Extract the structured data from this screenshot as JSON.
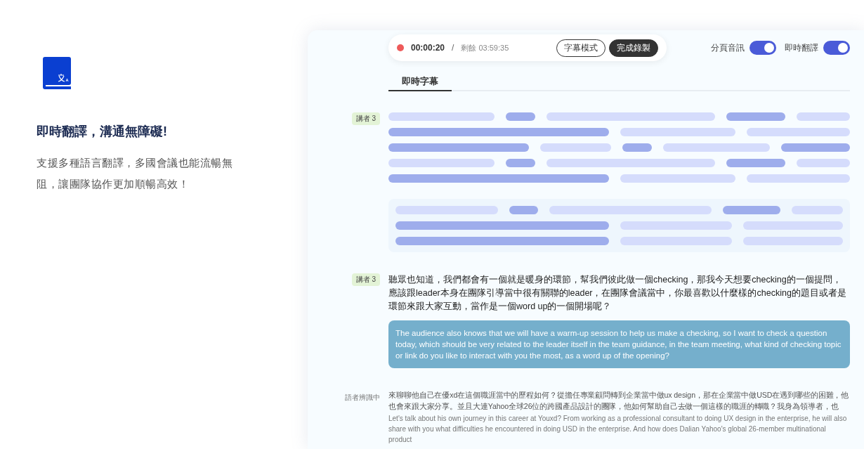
{
  "feature": {
    "title": "即時翻譯，溝通無障礙!",
    "description": "支援多種語言翻譯，多國會議也能流暢無阻，讓團隊協作更加順暢高效！"
  },
  "recorder": {
    "recording": true,
    "elapsed": "00:00:20",
    "separator": "/",
    "remaining": "剩餘 03:59:35",
    "buttons": [
      {
        "label": "字幕模式",
        "kind": "outline"
      },
      {
        "label": "完成錄製",
        "kind": "filled"
      }
    ]
  },
  "toggles": [
    {
      "label": "分頁音訊",
      "on": true
    },
    {
      "label": "即時翻譯",
      "on": true
    }
  ],
  "tabs": [
    {
      "label": "即時字幕",
      "selected": true
    }
  ],
  "transcript": [
    {
      "kind": "skeleton",
      "speaker": "講者 3"
    },
    {
      "kind": "translated",
      "speaker": "講者 3",
      "text": "聽眾也知道，我們都會有一個就是暖身的環節，幫我們彼此做一個checking，那我今天想要checking的一個提問，應該跟leader本身在團隊引導當中很有關聯的leader，在團隊會議當中，你最喜歡以什麼樣的checking的題目或者是環節來跟大家互動，當作是一個word up的一個開場呢？",
      "translation": "The audience also knows that we will have a warm-up session to help us make a checking, so I want to check a question today, which should be very related to the leader itself in the team guidance, in the team meeting, what kind of checking topic or link do you like to interact with you the most, as a word up of the opening?"
    },
    {
      "kind": "recognizing",
      "speaker": "語者辨識中",
      "text": "來聊聊他自己在優xd在這個職涯當中的歷程如何？從擔任專業顧問轉到企業當中做ux design，那在企業當中做USD在遇到哪些的困難，他也會來跟大家分享。並且大連Yahoo全球26位的跨國產品設計的團隊，他如何幫助自己去做一個這樣的職涯的轉職？我身為領導者，也",
      "translation": "Let's talk about his own journey in this career at Youxd? From working as a professional consultant to doing UX design in the enterprise, he will also share with you what difficulties he encountered in doing USD in the enterprise. And how does Dalian Yahoo's global 26-member multinational product"
    }
  ]
}
